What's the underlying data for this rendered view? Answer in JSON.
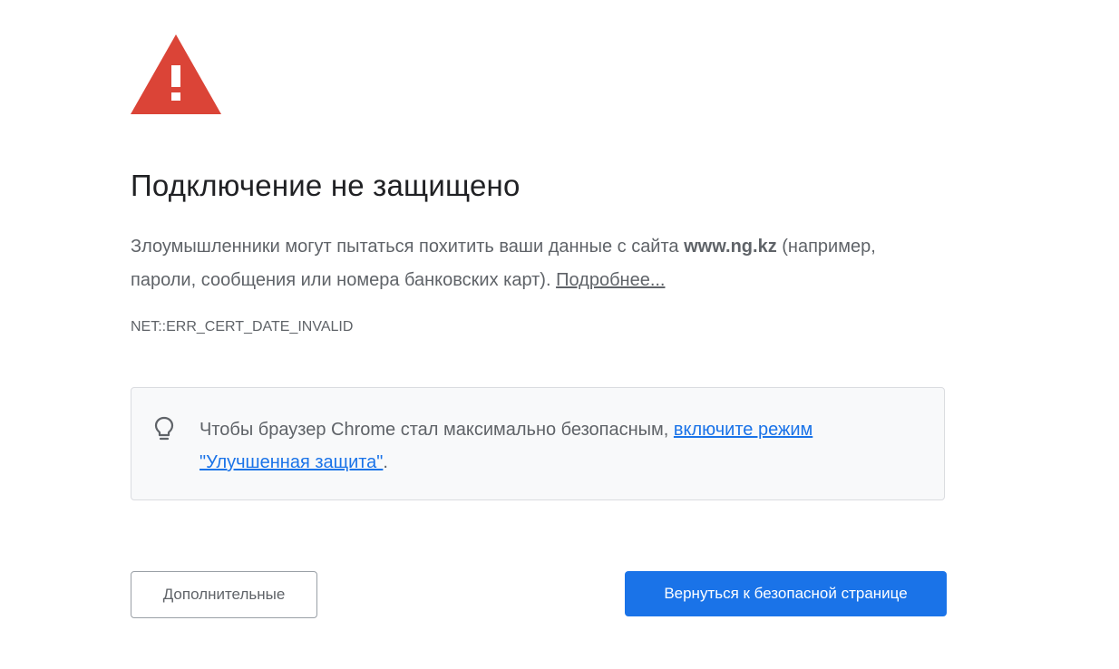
{
  "title": "Подключение не защищено",
  "description": {
    "text_before": "Злоумышленники могут пытаться похитить ваши данные с сайта ",
    "domain": "www.ng.kz",
    "text_after": " (например, пароли, сообщения или номера банковских карт). ",
    "more_link": "Подробнее..."
  },
  "error_code": "NET::ERR_CERT_DATE_INVALID",
  "tip": {
    "icon": "lightbulb-icon",
    "text_before": "Чтобы браузер Chrome стал максимально безопасным, ",
    "link": "включите режим \"Улучшенная защита\"",
    "text_after": "."
  },
  "buttons": {
    "advanced": "Дополнительные",
    "back_to_safety": "Вернуться к безопасной странице"
  },
  "colors": {
    "warning_red": "#db4437",
    "primary_blue": "#1a73e8",
    "text_gray": "#5f6368",
    "tip_background": "#f8f9fa"
  },
  "icons": {
    "warning": "warning-triangle-icon"
  }
}
